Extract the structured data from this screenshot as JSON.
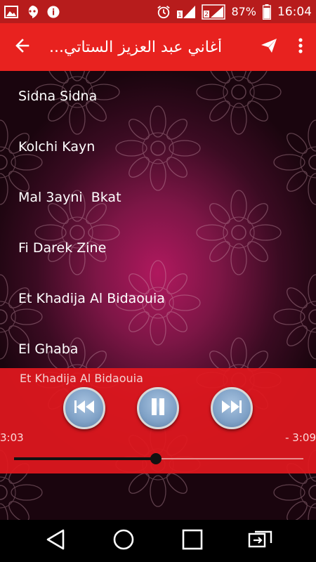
{
  "status_bar": {
    "left_icons": [
      "image-icon",
      "hangouts-icon",
      "hangouts-icon"
    ],
    "battery": "87%",
    "time": "16:04",
    "sim1_label": "1",
    "sim2_label": "2"
  },
  "app_bar": {
    "title": "أغاني عبد العزيز الستاتي..."
  },
  "songs": [
    "Sidna Sidna",
    "Kolchi Kayn",
    "Mal 3ayni  Bkat",
    "Fi Darek Zine",
    "Et Khadija Al Bidaouia",
    "El Ghaba"
  ],
  "player": {
    "now_playing": "Et Khadija Al Bidaouia",
    "elapsed": "3:03",
    "remaining": "- 3:09",
    "progress": 0.49
  },
  "colors": {
    "accent": "#e8221f",
    "status_bar": "#b71c1c",
    "player_bg": "#e1181e"
  }
}
